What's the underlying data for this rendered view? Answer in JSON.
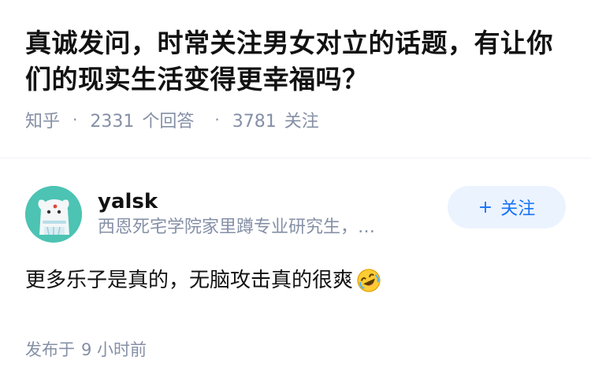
{
  "question": {
    "title": "真诚发问，时常关注男女对立的话题，有让你们的现实生活变得更幸福吗？",
    "source": "知乎",
    "answer_count": "2331",
    "answer_label": "个回答",
    "follower_count": "3781",
    "follower_label": "关注"
  },
  "answer": {
    "author": {
      "name": "yalsk",
      "bio": "西恩死宅学院家里蹲专业研究生，…"
    },
    "follow_button": {
      "plus": "+",
      "label": "关注"
    },
    "content": "更多乐子是真的，无脑攻击真的很爽",
    "emoji": "rolling-on-floor-laughing",
    "published_prefix": "发布于",
    "published_time": "9 小时前"
  },
  "colors": {
    "title": "#121212",
    "meta": "#8590a6",
    "accent": "#1772f6",
    "follow_bg": "#ebf3fe",
    "avatar_bg": "#4cc3b3"
  }
}
